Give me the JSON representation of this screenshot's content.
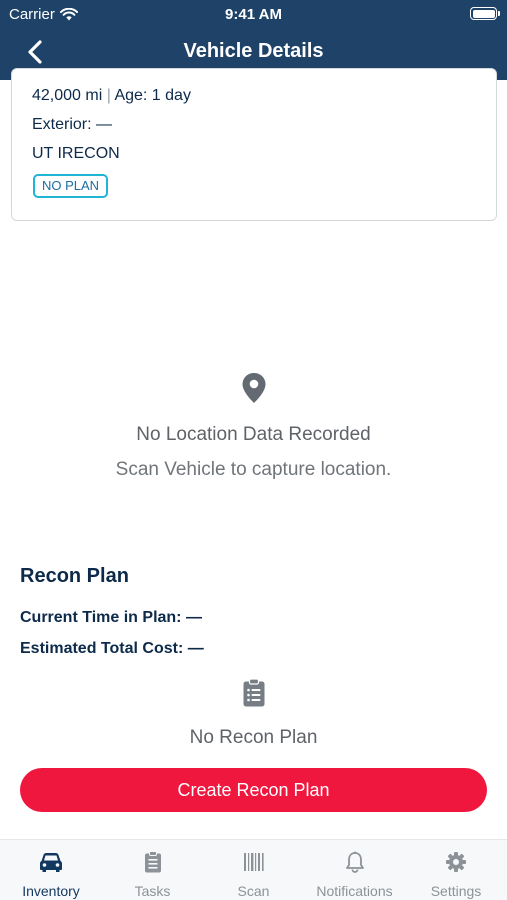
{
  "status_bar": {
    "carrier": "Carrier",
    "time": "9:41 AM"
  },
  "nav": {
    "title": "Vehicle Details"
  },
  "vehicle": {
    "mileage": "42,000 mi",
    "separator": "|",
    "age": "Age: 1 day",
    "exterior": "Exterior: —",
    "location_code": "UT IRECON",
    "plan_badge": "NO PLAN"
  },
  "location": {
    "title": "No Location Data Recorded",
    "subtitle": "Scan Vehicle to capture location."
  },
  "recon": {
    "title": "Recon Plan",
    "current_time": "Current Time in Plan: —",
    "estimated_cost": "Estimated Total Cost: —",
    "empty": "No Recon Plan",
    "create_button": "Create Recon Plan"
  },
  "tabs": [
    {
      "label": "Inventory",
      "icon": "car-icon",
      "active": true
    },
    {
      "label": "Tasks",
      "icon": "clipboard-icon",
      "active": false
    },
    {
      "label": "Scan",
      "icon": "barcode-icon",
      "active": false
    },
    {
      "label": "Notifications",
      "icon": "bell-icon",
      "active": false
    },
    {
      "label": "Settings",
      "icon": "gear-icon",
      "active": false
    }
  ],
  "colors": {
    "header": "#1e4268",
    "primary_text": "#0d2a4a",
    "accent_red": "#f0173f",
    "badge_border": "#1fb6d6",
    "inactive_tab": "#8c9298"
  }
}
